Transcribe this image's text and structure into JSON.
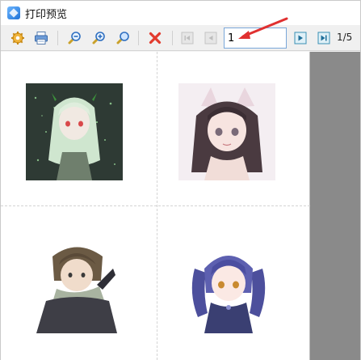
{
  "window": {
    "title": "打印预览"
  },
  "toolbar": {
    "icons": {
      "settings": "gear-icon",
      "print": "printer-icon",
      "zoom_out": "zoom-out-icon",
      "zoom_in": "zoom-in-icon",
      "zoom_fit": "zoom-fit-icon",
      "close": "close-icon",
      "first": "first-page-icon",
      "prev": "previous-page-icon",
      "next": "next-page-icon",
      "last": "last-page-icon"
    },
    "page_input_value": "1",
    "page_count": "1/5"
  },
  "preview": {
    "thumbnails": [
      {
        "name": "anime-girl-green-portrait"
      },
      {
        "name": "anime-girl-cat-ears-portrait"
      },
      {
        "name": "anime-boy-scarf-portrait"
      },
      {
        "name": "anime-girl-twintails-portrait"
      }
    ]
  },
  "colors": {
    "accent": "#2f80d0",
    "close_red": "#e23b2e",
    "arrow_red": "#e03030",
    "preview_bg": "#8a8a8a"
  }
}
